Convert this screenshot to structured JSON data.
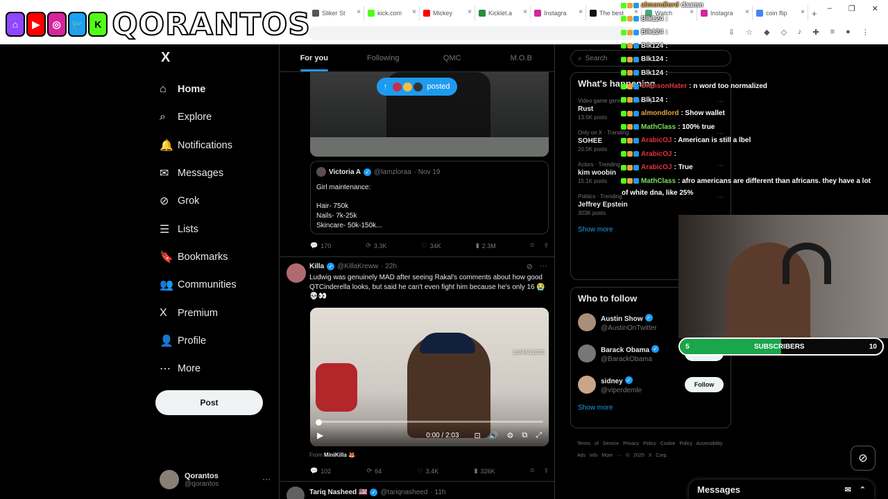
{
  "browser": {
    "tabs": [
      "Sliker St",
      "kick.com",
      "Mickey",
      "Kicklet.a",
      "Instagra",
      "The best",
      "Watch",
      "Instagra",
      "coin flip"
    ],
    "new_tab": "+",
    "window_controls": [
      "–",
      "❐",
      "✕"
    ]
  },
  "stream_overlay": {
    "logo_text": "QORANTOS",
    "social_icons": [
      "twitch-icon",
      "youtube-icon",
      "instagram-icon",
      "twitter-icon",
      "kick-icon"
    ],
    "subscriber_bar": {
      "current": "5",
      "label": "SUBSCRIBERS",
      "goal": "10",
      "progress": 0.5
    },
    "chat": [
      {
        "user": "almondlord",
        "text": "daamn",
        "color": "#e8a43a"
      },
      {
        "user": "Blk124",
        "text": ":",
        "color": "#e7e9ea"
      },
      {
        "user": "Blk124",
        "text": ":",
        "color": "#e7e9ea"
      },
      {
        "user": "Blk124",
        "text": ":",
        "color": "#e7e9ea"
      },
      {
        "user": "Blk124",
        "text": ":",
        "color": "#e7e9ea"
      },
      {
        "user": "Blk124",
        "text": ":",
        "color": "#e7e9ea"
      },
      {
        "user": "CrimsonHater",
        "text": ": n word too normalized",
        "color": "#e0323c"
      },
      {
        "user": "Blk124",
        "text": ":",
        "color": "#e7e9ea"
      },
      {
        "user": "almondlord",
        "text": ": Show wallet",
        "color": "#e8a43a"
      },
      {
        "user": "MathClass",
        "text": ": 100% true",
        "color": "#7ae05a"
      },
      {
        "user": "ArabicOJ",
        "text": ": American is still a lbel",
        "color": "#e0323c"
      },
      {
        "user": "ArabicOJ",
        "text": ":",
        "color": "#e0323c"
      },
      {
        "user": "ArabicOJ",
        "text": ": True",
        "color": "#e0323c"
      },
      {
        "user": "MathClass",
        "text": ": afro americans are different than africans. they have a lot",
        "color": "#7ae05a"
      }
    ],
    "chat_continuation": "of white dna, like 25%"
  },
  "sidebar": {
    "logo": "X",
    "items": [
      {
        "label": "Home",
        "icon": "home-icon",
        "glyph": "⌂"
      },
      {
        "label": "Explore",
        "icon": "search-icon",
        "glyph": "⌕"
      },
      {
        "label": "Notifications",
        "icon": "bell-icon",
        "glyph": "🔔"
      },
      {
        "label": "Messages",
        "icon": "mail-icon",
        "glyph": "✉"
      },
      {
        "label": "Grok",
        "icon": "grok-icon",
        "glyph": "⊘"
      },
      {
        "label": "Lists",
        "icon": "list-icon",
        "glyph": "☰"
      },
      {
        "label": "Bookmarks",
        "icon": "bookmark-icon",
        "glyph": "🔖"
      },
      {
        "label": "Communities",
        "icon": "people-icon",
        "glyph": "👥"
      },
      {
        "label": "Premium",
        "icon": "x-icon",
        "glyph": "X"
      },
      {
        "label": "Profile",
        "icon": "person-icon",
        "glyph": "👤"
      },
      {
        "label": "More",
        "icon": "more-circle-icon",
        "glyph": "⋯"
      }
    ],
    "post_button": "Post",
    "account": {
      "name": "Qorantos",
      "handle": "@qorantos",
      "menu": "···"
    }
  },
  "feed": {
    "tabs": [
      "For you",
      "Following",
      "QMC",
      "M.O.B"
    ],
    "posted_pill": "posted",
    "quote": {
      "name": "Victoria A",
      "handle": "@lamzloraa",
      "date": "· Nov 19",
      "lines": [
        "Girl maintenance:",
        "",
        "Hair- 750k",
        "Nails- 7k-25k",
        "Skincare- 50k-150k..."
      ]
    },
    "post1_actions": {
      "replies": "170",
      "reposts": "3.3K",
      "likes": "34K",
      "views": "2.3M"
    },
    "post2": {
      "name": "Killa",
      "handle": "@KillaKreww",
      "time": "· 22h",
      "text": "Ludwig was genuinely MAD after seeing Rakal's comments about how good QTCinderella looks, but said he can't even fight him because he's only 16 😭💀👀",
      "video_counter": "11849/12000",
      "video_time": "0:00 / 2:03",
      "video_progress": 0,
      "from_label": "From",
      "from_name": "MiniKilla 🦊",
      "actions": {
        "replies": "102",
        "reposts": "64",
        "likes": "3.4K",
        "views": "326K"
      }
    },
    "post3": {
      "name": "Tariq Nasheed 🇺🇸",
      "handle": "@tariqnasheed",
      "time": "· 11h"
    }
  },
  "right": {
    "search_placeholder": "Search",
    "happening_title": "What's happening",
    "trends": [
      {
        "category": "Video game genres · Trending",
        "title": "Rust",
        "posts": "13.5K posts"
      },
      {
        "category": "Only on X · Trending",
        "title": "SOHEE",
        "posts": "20.5K posts"
      },
      {
        "category": "Actors · Trending",
        "title": "kim woobin",
        "posts": "15.1K posts"
      },
      {
        "category": "Politics · Trending",
        "title": "Jeffrey Epstein",
        "posts": "303K posts"
      }
    ],
    "show_more": "Show more",
    "who_to_follow_title": "Who to follow",
    "follow": [
      {
        "name": "Austin Show",
        "handle": "@AustinOnTwitter"
      },
      {
        "name": "Barack Obama",
        "handle": "@BarackObama"
      },
      {
        "name": "sidney",
        "handle": "@viperdemle"
      }
    ],
    "follow_label": "Follow",
    "show_more2": "Show more",
    "footer": "Terms of Service   Privacy Policy   Cookie Policy   Accessibility   Ads info   More ···   © 2025 X Corp."
  },
  "messages_dock": {
    "title": "Messages"
  }
}
